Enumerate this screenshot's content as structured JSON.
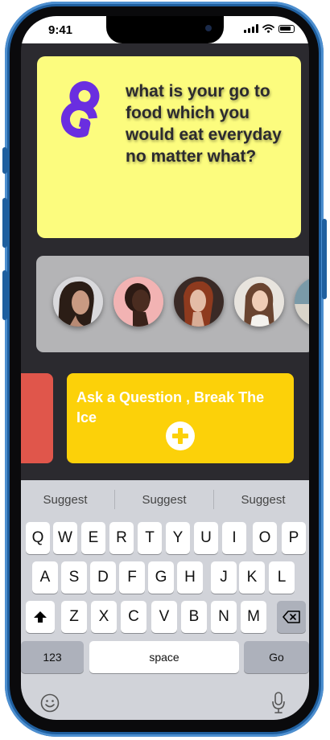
{
  "status_bar": {
    "time": "9:41"
  },
  "question_card": {
    "logo": "brand-logo-g",
    "question": "what is your go to food which you would eat everyday no matter what?"
  },
  "avatars": [
    "avatar-woman-dark-hair",
    "avatar-woman-shaved-head",
    "avatar-woman-red-hair",
    "avatar-woman-brown-hair",
    "avatar-partial"
  ],
  "ask_card": {
    "label": "Ask a Question , Break The Ice",
    "icon": "plus-circle-icon"
  },
  "keyboard": {
    "suggestions": [
      "Suggest",
      "Suggest",
      "Suggest"
    ],
    "row1": [
      "Q",
      "W",
      "E",
      "R",
      "T",
      "Y",
      "U",
      "I",
      "O",
      "P"
    ],
    "row2": [
      "A",
      "S",
      "D",
      "F",
      "G",
      "H",
      "J",
      "K",
      "L"
    ],
    "row3": [
      "Z",
      "X",
      "C",
      "V",
      "B",
      "N",
      "M"
    ],
    "numbers_label": "123",
    "space_label": "space",
    "go_label": "Go"
  },
  "colors": {
    "question_card": "#fcfc7e",
    "ask_card": "#fcd109",
    "red_card": "#e0564b",
    "logo": "#6a2ee0",
    "background": "#2b2a2f"
  }
}
